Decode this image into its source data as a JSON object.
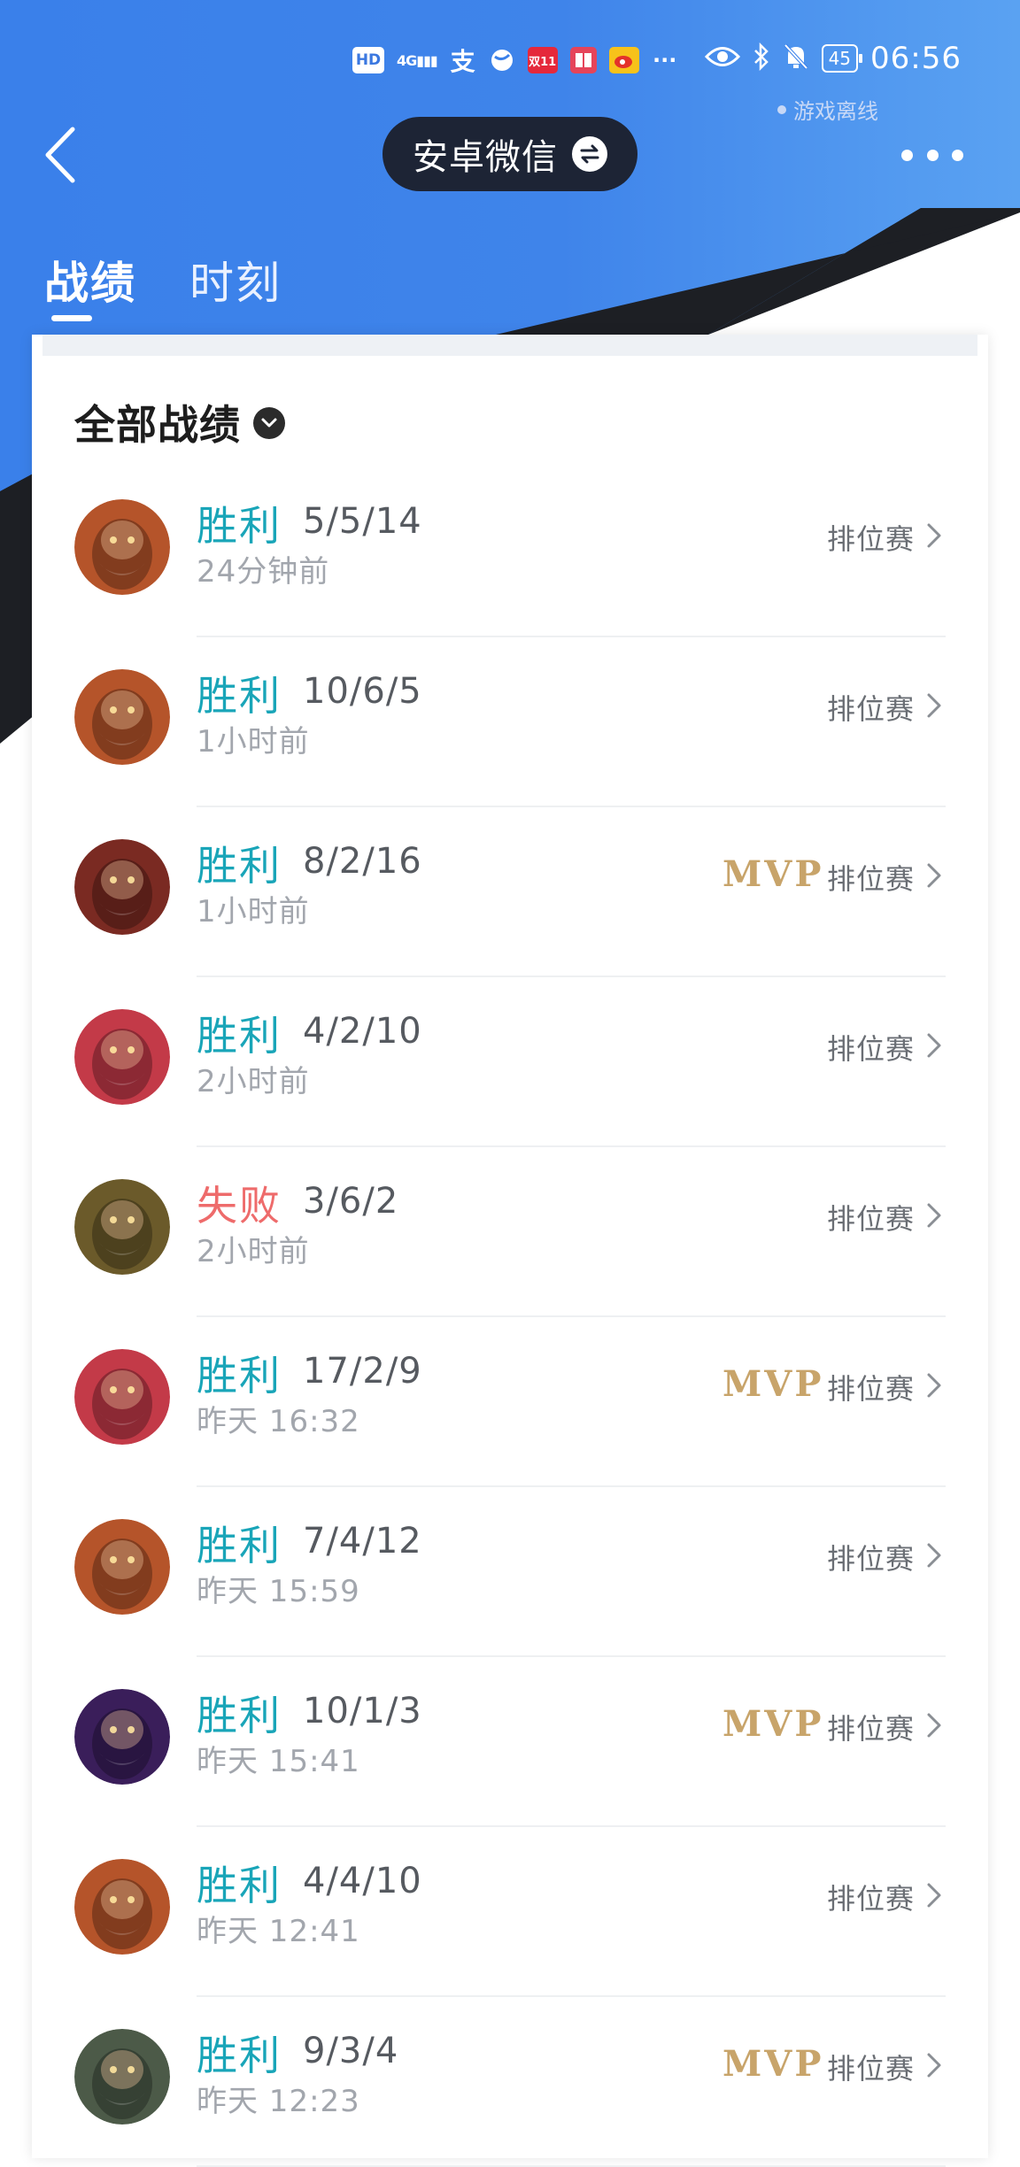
{
  "status_bar": {
    "hd": "HD",
    "signal": "4G",
    "icons": [
      "hd-icon",
      "signal-4g-icon",
      "alipay-icon",
      "browser-icon",
      "shopping-icon",
      "reader-icon",
      "weibo-icon",
      "more-icon"
    ],
    "red_badge": "双11",
    "overflow": "···",
    "battery": "45",
    "time": "06:56"
  },
  "header": {
    "status": "游戏离线",
    "account_name": "安卓微信"
  },
  "tabs": [
    {
      "label": "战绩",
      "active": true
    },
    {
      "label": "时刻",
      "active": false
    }
  ],
  "filter": {
    "label": "全部战绩"
  },
  "matches": [
    {
      "result": "胜利",
      "kda": "5/5/14",
      "time": "24分钟前",
      "mvp": "",
      "mode": "排位赛",
      "win": true,
      "hero_color": "#b5542a"
    },
    {
      "result": "胜利",
      "kda": "10/6/5",
      "time": "1小时前",
      "mvp": "",
      "mode": "排位赛",
      "win": true,
      "hero_color": "#b5542a"
    },
    {
      "result": "胜利",
      "kda": "8/2/16",
      "time": "1小时前",
      "mvp": "MVP",
      "mode": "排位赛",
      "win": true,
      "hero_color": "#7a2a22"
    },
    {
      "result": "胜利",
      "kda": "4/2/10",
      "time": "2小时前",
      "mvp": "",
      "mode": "排位赛",
      "win": true,
      "hero_color": "#c33a48"
    },
    {
      "result": "失败",
      "kda": "3/6/2",
      "time": "2小时前",
      "mvp": "",
      "mode": "排位赛",
      "win": false,
      "hero_color": "#6b5a2a"
    },
    {
      "result": "胜利",
      "kda": "17/2/9",
      "time": "昨天 16:32",
      "mvp": "MVP",
      "mode": "排位赛",
      "win": true,
      "hero_color": "#c33a48"
    },
    {
      "result": "胜利",
      "kda": "7/4/12",
      "time": "昨天 15:59",
      "mvp": "",
      "mode": "排位赛",
      "win": true,
      "hero_color": "#b5542a"
    },
    {
      "result": "胜利",
      "kda": "10/1/3",
      "time": "昨天 15:41",
      "mvp": "MVP",
      "mode": "排位赛",
      "win": true,
      "hero_color": "#3a1e5a"
    },
    {
      "result": "胜利",
      "kda": "4/4/10",
      "time": "昨天 12:41",
      "mvp": "",
      "mode": "排位赛",
      "win": true,
      "hero_color": "#b5542a"
    },
    {
      "result": "胜利",
      "kda": "9/3/4",
      "time": "昨天 12:23",
      "mvp": "MVP",
      "mode": "排位赛",
      "win": true,
      "hero_color": "#4c5a48"
    }
  ],
  "colors": {
    "banner_blue": "#3a7ee6",
    "banner_dark": "#1d1f24",
    "win": "#19a5b8",
    "loss": "#ee6b6b",
    "mvp_gold": "#c8a46a"
  }
}
